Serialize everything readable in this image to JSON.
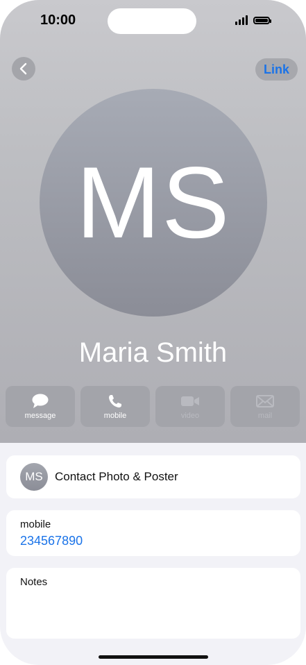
{
  "status_bar": {
    "time": "10:00"
  },
  "nav": {
    "link_label": "Link"
  },
  "contact": {
    "initials": "MS",
    "name": "Maria Smith"
  },
  "actions": [
    {
      "label": "message",
      "enabled": true
    },
    {
      "label": "mobile",
      "enabled": true
    },
    {
      "label": "video",
      "enabled": false
    },
    {
      "label": "mail",
      "enabled": false
    }
  ],
  "poster": {
    "initials": "MS",
    "label": "Contact Photo & Poster"
  },
  "phone": {
    "label": "mobile",
    "number": "234567890"
  },
  "notes": {
    "label": "Notes",
    "value": ""
  },
  "colors": {
    "accent": "#1a73e8",
    "header_bg": "#bdbec2",
    "card_bg": "#ffffff"
  }
}
